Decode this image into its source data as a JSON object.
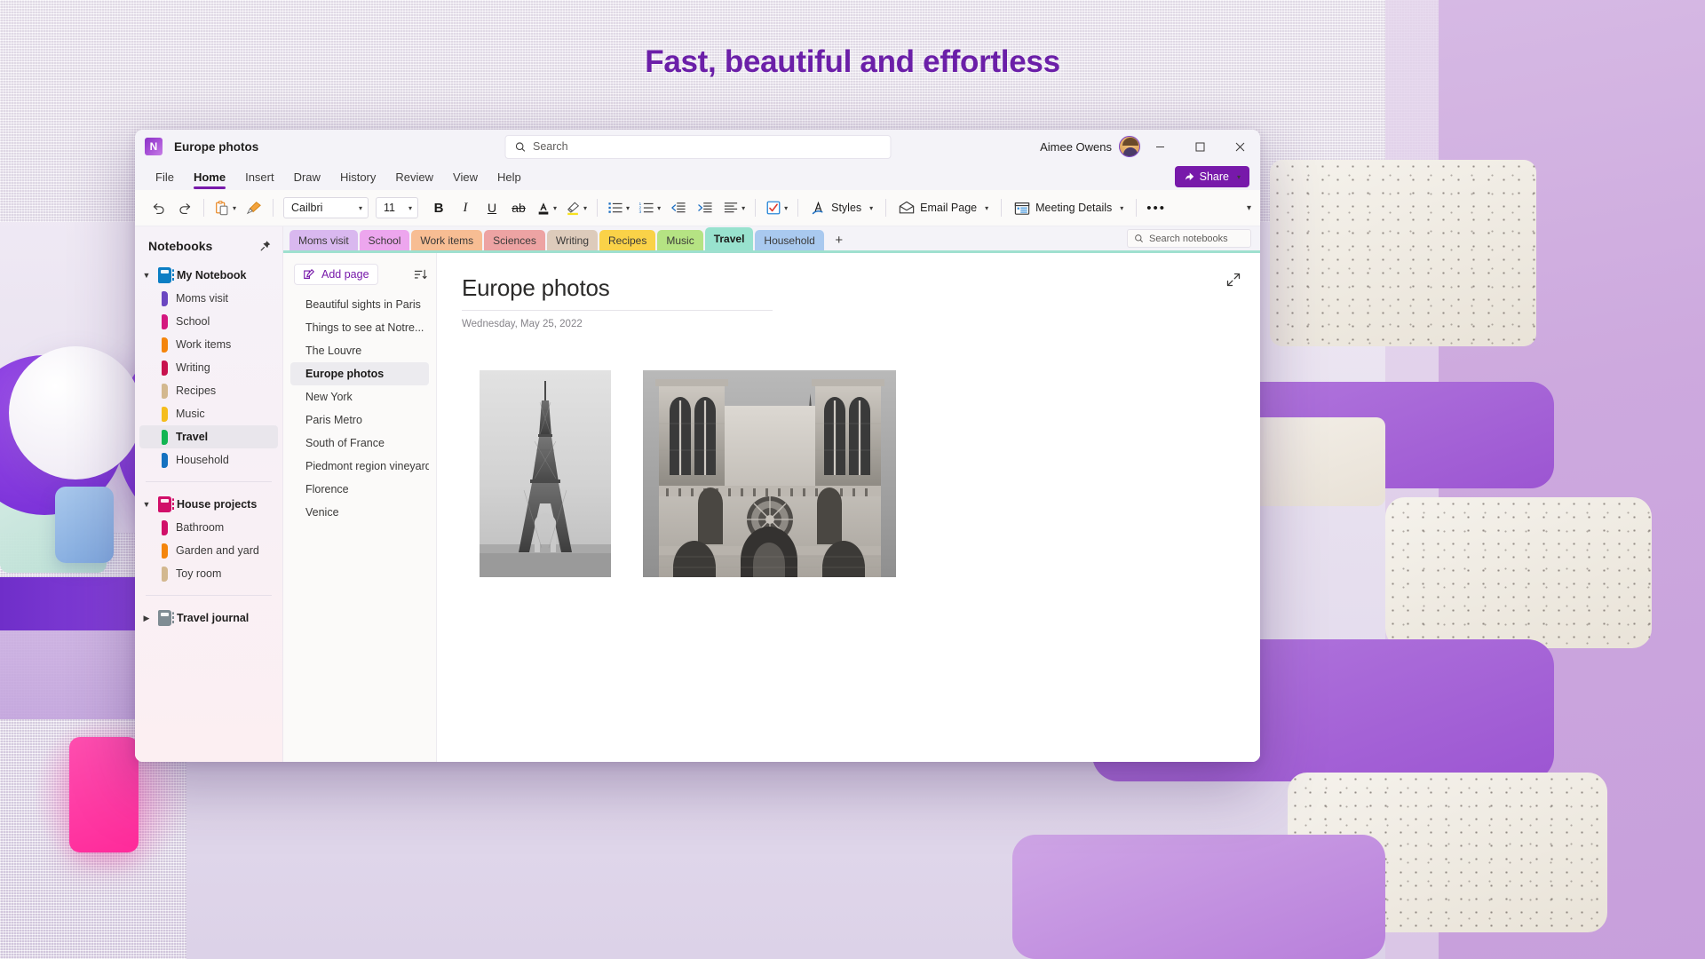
{
  "background": {
    "headline": "Fast, beautiful and effortless"
  },
  "window": {
    "app_icon": "onenote-logo-icon",
    "title": "Europe photos",
    "search": {
      "placeholder": "Search",
      "icon": "search-icon"
    },
    "user": {
      "name": "Aimee Owens",
      "avatar": "user-avatar"
    },
    "controls": {
      "minimize": "–",
      "maximize": "□",
      "close": "✕"
    }
  },
  "menubar": {
    "items": [
      "File",
      "Home",
      "Insert",
      "Draw",
      "History",
      "Review",
      "View",
      "Help"
    ],
    "active": "Home",
    "share_label": "Share",
    "accent": "#7719aa"
  },
  "ribbon": {
    "undo": "undo-icon",
    "redo": "redo-icon",
    "paste": "paste-icon",
    "format_painter": "format-painter-icon",
    "font_name": "Cailbri",
    "font_size": "11",
    "bold": "B",
    "italic": "I",
    "underline": "U",
    "strikethrough": "ab",
    "font_color": "font-color-icon",
    "highlight": "highlighter-icon",
    "bullets": "bulleted-list-icon",
    "numbering": "numbered-list-icon",
    "decrease_indent": "decrease-indent-icon",
    "increase_indent": "increase-indent-icon",
    "align": "align-icon",
    "todo_tag": "todo-checkbox-icon",
    "styles_label": "Styles",
    "email_page_label": "Email Page",
    "meeting_details_label": "Meeting Details",
    "overflow": "•••",
    "expand": "chevron-down-icon"
  },
  "sidebar": {
    "title": "Notebooks",
    "pin_icon": "pin-icon",
    "notebooks": [
      {
        "name": "My Notebook",
        "color": "#0b7ec4",
        "expanded": true,
        "sections": [
          {
            "label": "Moms visit",
            "color": "#6b46c1"
          },
          {
            "label": "School",
            "color": "#d4177f"
          },
          {
            "label": "Work items",
            "color": "#f4850c"
          },
          {
            "label": "Writing",
            "color": "#c8124e"
          },
          {
            "label": "Recipes",
            "color": "#d3b88f"
          },
          {
            "label": "Music",
            "color": "#f5bd1c"
          },
          {
            "label": "Travel",
            "color": "#12b552",
            "selected": true
          },
          {
            "label": "Household",
            "color": "#1572c0"
          }
        ]
      },
      {
        "name": "House projects",
        "color": "#d10f69",
        "expanded": true,
        "sections": [
          {
            "label": "Bathroom",
            "color": "#d10f69"
          },
          {
            "label": "Garden and yard",
            "color": "#f4850c"
          },
          {
            "label": "Toy room",
            "color": "#d3b88f"
          }
        ]
      },
      {
        "name": "Travel journal",
        "color": "#7f8c93",
        "expanded": false,
        "sections": []
      }
    ]
  },
  "tabstrip": {
    "pin_icon": "pin-icon",
    "tabs": [
      {
        "label": "Moms visit",
        "color": "#d9b8ef"
      },
      {
        "label": "School",
        "color": "#eda6ee"
      },
      {
        "label": "Work items",
        "color": "#f7bd93"
      },
      {
        "label": "Sciences",
        "color": "#eda3a3"
      },
      {
        "label": "Writing",
        "color": "#ddcbbb"
      },
      {
        "label": "Recipes",
        "color": "#fad248"
      },
      {
        "label": "Music",
        "color": "#b5e383"
      },
      {
        "label": "Travel",
        "color": "#98e2ce",
        "active": true
      },
      {
        "label": "Household",
        "color": "#a9c9ef"
      }
    ],
    "add_tab": "+",
    "search": {
      "placeholder": "Search notebooks",
      "icon": "search-icon"
    },
    "underline_color": "#9fe0cf"
  },
  "pagelist": {
    "add_page_label": "Add page",
    "add_page_icon": "add-page-icon",
    "sort_icon": "sort-icon",
    "pages": [
      {
        "label": "Beautiful sights in Paris"
      },
      {
        "label": "Things to see at Notre..."
      },
      {
        "label": "The Louvre"
      },
      {
        "label": "Europe photos",
        "selected": true
      },
      {
        "label": "New York"
      },
      {
        "label": "Paris Metro"
      },
      {
        "label": "South of France"
      },
      {
        "label": "Piedmont region vineyards"
      },
      {
        "label": "Florence"
      },
      {
        "label": "Venice"
      }
    ]
  },
  "page": {
    "title": "Europe photos",
    "date": "Wednesday, May 25, 2022",
    "expand_icon": "expand-icon",
    "images": [
      {
        "name": "eiffel-tower-photo",
        "alt": "Eiffel Tower"
      },
      {
        "name": "notre-dame-photo",
        "alt": "Notre Dame cathedral facade"
      }
    ]
  }
}
